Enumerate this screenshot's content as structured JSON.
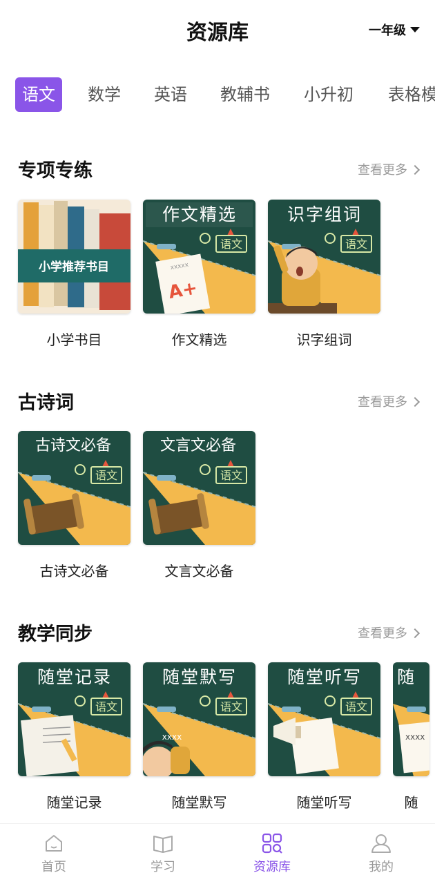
{
  "header": {
    "title": "资源库",
    "grade": "一年级"
  },
  "tabs": [
    "语文",
    "数学",
    "英语",
    "教辅书",
    "小升初",
    "表格模"
  ],
  "sections": [
    {
      "title": "专项专练",
      "more": "查看更多",
      "items": [
        {
          "label": "小学书目",
          "banner": "小学推荐书目"
        },
        {
          "label": "作文精选",
          "cover_title": "作文精选",
          "badge": "语文",
          "paper_text": "xxxxx",
          "grade_text": "A+"
        },
        {
          "label": "识字组词",
          "cover_title": "识字组词",
          "badge": "语文"
        }
      ]
    },
    {
      "title": "古诗词",
      "more": "查看更多",
      "items": [
        {
          "label": "古诗文必备",
          "cover_title": "古诗文必备",
          "badge": "语文"
        },
        {
          "label": "文言文必备",
          "cover_title": "文言文必备",
          "badge": "语文"
        }
      ]
    },
    {
      "title": "教学同步",
      "more": "查看更多",
      "items": [
        {
          "label": "随堂记录",
          "cover_title": "随堂记录",
          "badge": "语文"
        },
        {
          "label": "随堂默写",
          "cover_title": "随堂默写",
          "badge": "语文",
          "board_text": "xxxx"
        },
        {
          "label": "随堂听写",
          "cover_title": "随堂听写",
          "badge": "语文"
        },
        {
          "label": "随",
          "cover_title": "随",
          "paper_text": "xxxx"
        }
      ]
    }
  ],
  "bottom_nav": [
    {
      "label": "首页",
      "icon": "home-icon"
    },
    {
      "label": "学习",
      "icon": "book-icon"
    },
    {
      "label": "资源库",
      "icon": "grid-search-icon",
      "active": true
    },
    {
      "label": "我的",
      "icon": "user-icon"
    }
  ],
  "colors": {
    "accent": "#8a55e8",
    "board": "#1f4d42",
    "board_yellow": "#f3b94d"
  }
}
